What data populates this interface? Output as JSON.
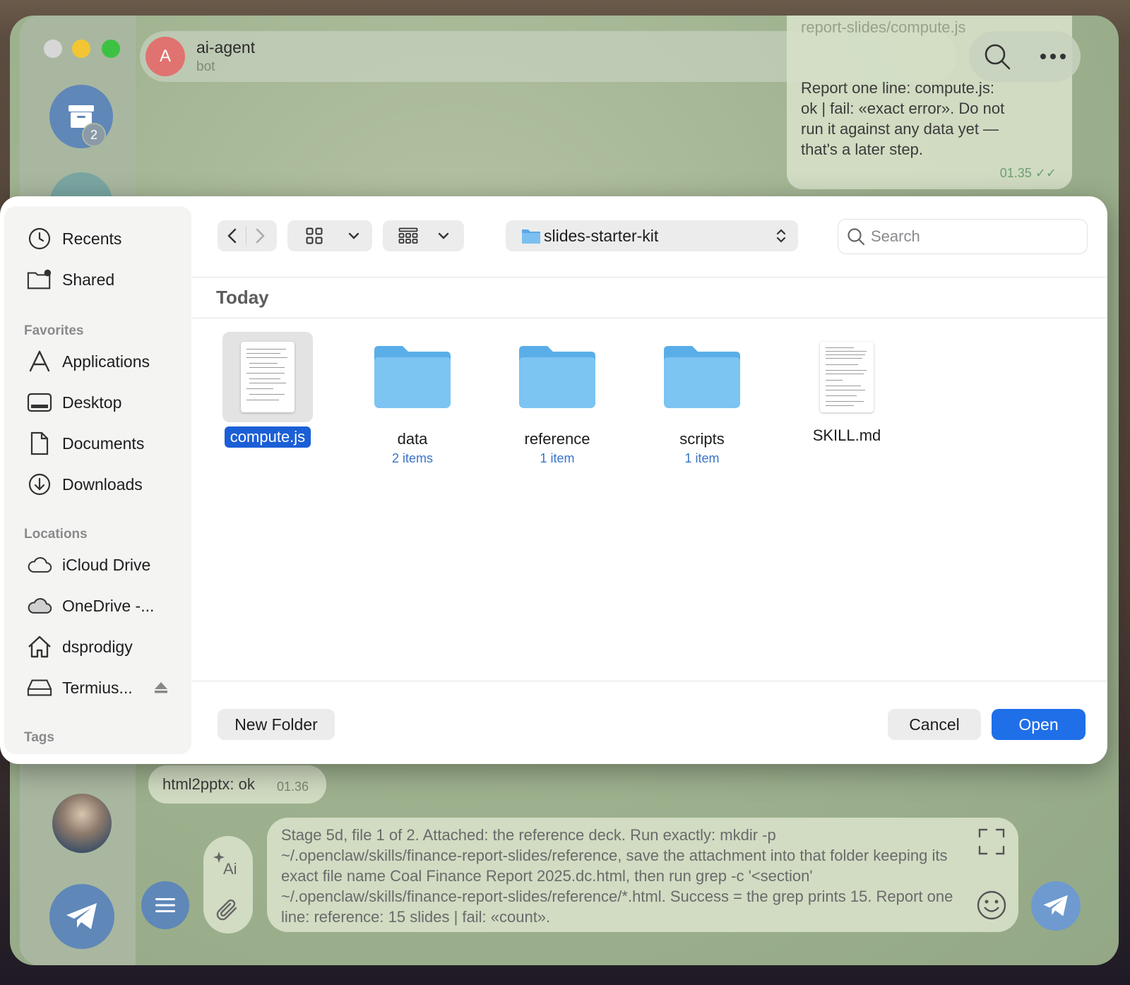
{
  "telegram": {
    "chat": {
      "avatar_letter": "A",
      "name": "ai-agent",
      "status": "bot"
    },
    "archive_badge": "2",
    "messages": {
      "top_faded": "report-slides/compute.js",
      "top_text": "Report one line: compute.js: ok | fail: «exact error». Do not run it against any data yet — that's a later step.",
      "top_time": "01.35",
      "bottom_text": "html2pptx: ok",
      "bottom_time": "01.36"
    },
    "compose_text": "Stage 5d, file 1 of 2. Attached: the reference deck. Run exactly: mkdir -p ~/.openclaw/skills/finance-report-slides/reference, save the attachment into that folder keeping its exact file name Coal Finance Report 2025.dc.html, then run grep -c '<section' ~/.openclaw/skills/finance-report-slides/reference/*.html. Success = the grep prints 15. Report one line: reference: 15 slides | fail: «count»."
  },
  "dialog": {
    "sidebar": {
      "top_items": [
        {
          "label": "Recents",
          "icon": "clock-icon"
        },
        {
          "label": "Shared",
          "icon": "shared-folder-icon"
        }
      ],
      "favorites_title": "Favorites",
      "favorites": [
        {
          "label": "Applications",
          "icon": "applications-icon"
        },
        {
          "label": "Desktop",
          "icon": "desktop-icon"
        },
        {
          "label": "Documents",
          "icon": "document-icon"
        },
        {
          "label": "Downloads",
          "icon": "download-icon"
        }
      ],
      "locations_title": "Locations",
      "locations": [
        {
          "label": "iCloud Drive",
          "icon": "cloud-icon"
        },
        {
          "label": "OneDrive -...",
          "icon": "cloud-filled-icon"
        },
        {
          "label": "dsprodigy",
          "icon": "home-icon"
        },
        {
          "label": "Termius...",
          "icon": "drive-icon"
        }
      ],
      "tags_title": "Tags"
    },
    "location": "slides-starter-kit",
    "search_placeholder": "Search",
    "section_title": "Today",
    "files": [
      {
        "name": "compute.js",
        "count": "",
        "kind": "document",
        "selected": true
      },
      {
        "name": "data",
        "count": "2 items",
        "kind": "folder",
        "selected": false
      },
      {
        "name": "reference",
        "count": "1 item",
        "kind": "folder",
        "selected": false
      },
      {
        "name": "scripts",
        "count": "1 item",
        "kind": "folder",
        "selected": false
      },
      {
        "name": "SKILL.md",
        "count": "",
        "kind": "document",
        "selected": false
      }
    ],
    "buttons": {
      "new_folder": "New Folder",
      "cancel": "Cancel",
      "open": "Open"
    },
    "colors": {
      "accent": "#1f6fe8",
      "selection": "#1b5fd6",
      "folder": "#6db8ec"
    }
  }
}
